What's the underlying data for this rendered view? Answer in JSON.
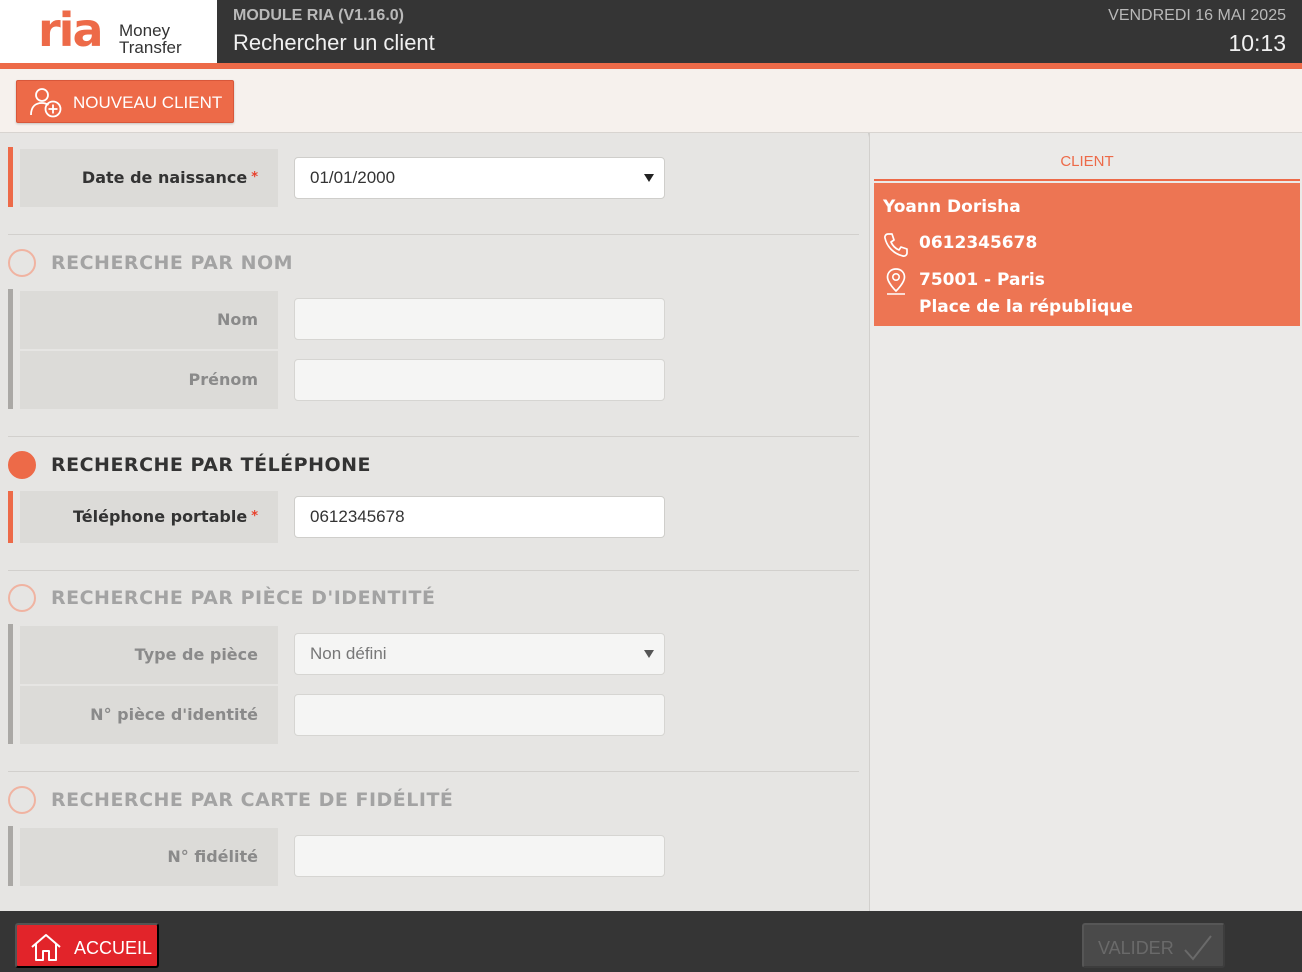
{
  "header": {
    "logo_text": "ria",
    "logo_sub_line1": "Money",
    "logo_sub_line2": "Transfer",
    "module": "MODULE RIA (V1.16.0)",
    "title": "Rechercher un client",
    "date": "VENDREDI 16 MAI 2025",
    "time": "10:13"
  },
  "toolbar": {
    "new_client_label": "NOUVEAU CLIENT"
  },
  "form": {
    "birthdate": {
      "label": "Date de naissance",
      "required": "*",
      "value": "01/01/2000"
    },
    "by_name": {
      "title": "RECHERCHE PAR NOM",
      "last_name_label": "Nom",
      "last_name_value": "",
      "first_name_label": "Prénom",
      "first_name_value": ""
    },
    "by_phone": {
      "title": "RECHERCHE PAR TÉLÉPHONE",
      "mobile_label": "Téléphone portable",
      "required": "*",
      "mobile_value": "0612345678"
    },
    "by_id": {
      "title": "RECHERCHE PAR PIÈCE D'IDENTITÉ",
      "type_label": "Type de pièce",
      "type_value": "Non défini",
      "number_label": "N° pièce d'identité",
      "number_value": ""
    },
    "by_loyalty": {
      "title": "RECHERCHE PAR CARTE DE FIDÉLITÉ",
      "number_label": "N° fidélité",
      "number_value": ""
    }
  },
  "client_panel": {
    "header": "CLIENT",
    "name": "Yoann Dorisha",
    "phone": "0612345678",
    "city_line": "75001 - Paris",
    "street_line": "Place de la république"
  },
  "footer": {
    "home_label": "ACCUEIL",
    "validate_label": "VALIDER"
  },
  "colors": {
    "brand": "#ed6a48",
    "header_bg": "#353535",
    "home_button": "#e2242a",
    "required": "#e8412c"
  },
  "icons": {
    "new_client": "add-user-icon",
    "home": "home-icon",
    "validate": "check-icon",
    "phone": "phone-icon",
    "location": "map-pin-icon"
  }
}
